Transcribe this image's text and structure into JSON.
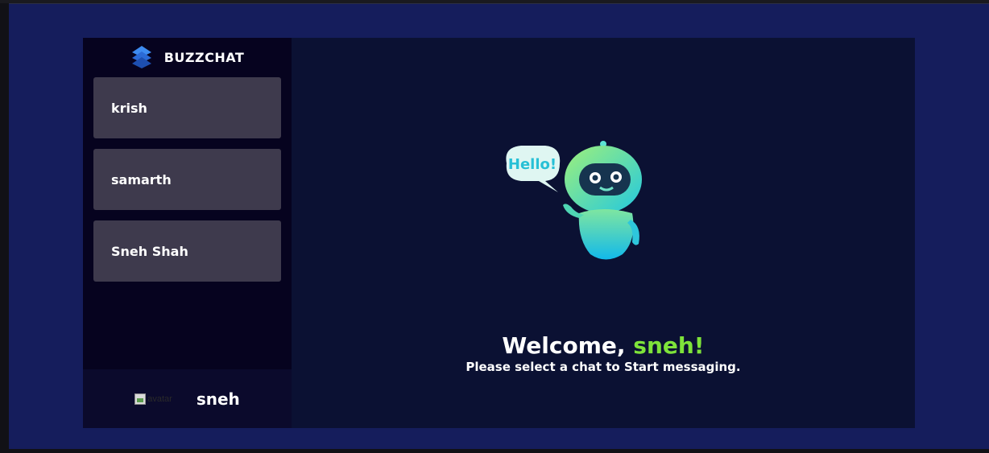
{
  "brand": {
    "name": "BUZZCHAT",
    "logo_icon": "buzzchat-logo-icon"
  },
  "contacts": [
    {
      "name": "krish"
    },
    {
      "name": "samarth"
    },
    {
      "name": "Sneh Shah"
    }
  ],
  "current_user": {
    "avatar_alt": "avatar",
    "name": "sneh"
  },
  "welcome": {
    "greeting": "Welcome,",
    "username": "sneh!",
    "subtitle": "Please select a chat to Start messaging.",
    "illustration_icon": "robot-hello-icon",
    "bubble_text": "Hello!"
  },
  "colors": {
    "background": "#151d5c",
    "sidebar": "#06031f",
    "contact_card": "#3e3a4d",
    "main_panel": "#0b1133",
    "accent_green": "#7ee33a"
  }
}
